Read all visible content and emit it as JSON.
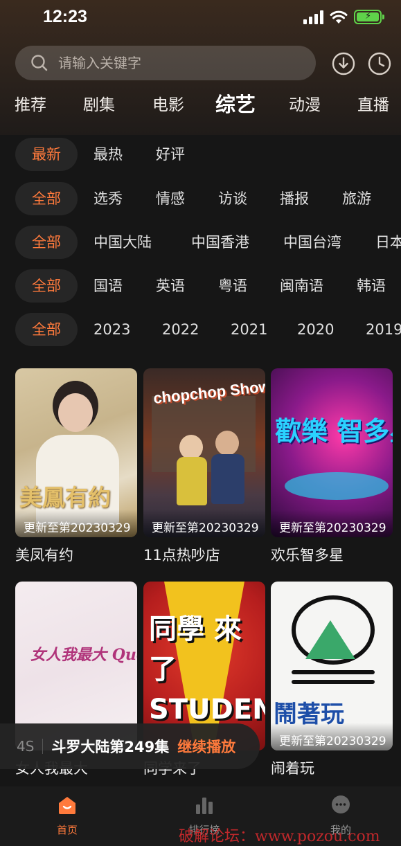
{
  "status": {
    "time": "12:23"
  },
  "search": {
    "placeholder": "请输入关键字"
  },
  "channels": [
    "推荐",
    "剧集",
    "电影",
    "综艺",
    "动漫",
    "直播"
  ],
  "filters": {
    "sort": [
      "最新",
      "最热",
      "好评"
    ],
    "type": [
      "全部",
      "选秀",
      "情感",
      "访谈",
      "播报",
      "旅游"
    ],
    "region": [
      "全部",
      "中国大陆",
      "中国香港",
      "中国台湾",
      "日本"
    ],
    "language": [
      "全部",
      "国语",
      "英语",
      "粤语",
      "闽南语",
      "韩语"
    ],
    "year": [
      "全部",
      "2023",
      "2022",
      "2021",
      "2020",
      "2019"
    ]
  },
  "cards": [
    {
      "title": "美凤有约",
      "update": "更新至第20230329",
      "art": "美鳳有約"
    },
    {
      "title": "11点热吵店",
      "update": "更新至第20230329",
      "art": "chopchop Show"
    },
    {
      "title": "欢乐智多星",
      "update": "更新至第20230329",
      "art": "歡樂 智多星"
    },
    {
      "title": "女人我最大",
      "update": "",
      "art": "女人我最大 Queen"
    },
    {
      "title": "同学来了",
      "update": "",
      "art": "同學 來了 STUDENT"
    },
    {
      "title": "闹着玩",
      "update": "更新至第20230329",
      "art": "鬧著玩"
    }
  ],
  "continue": {
    "time": "4S",
    "episode": "斗罗大陆第249集",
    "action": "继续播放"
  },
  "nav": {
    "home": "首页",
    "rank": "排行榜",
    "mine": "我的"
  },
  "watermark": "破解论坛：www.pozou.com",
  "colors": {
    "accent": "#ff7a3c",
    "background": "#161616"
  }
}
